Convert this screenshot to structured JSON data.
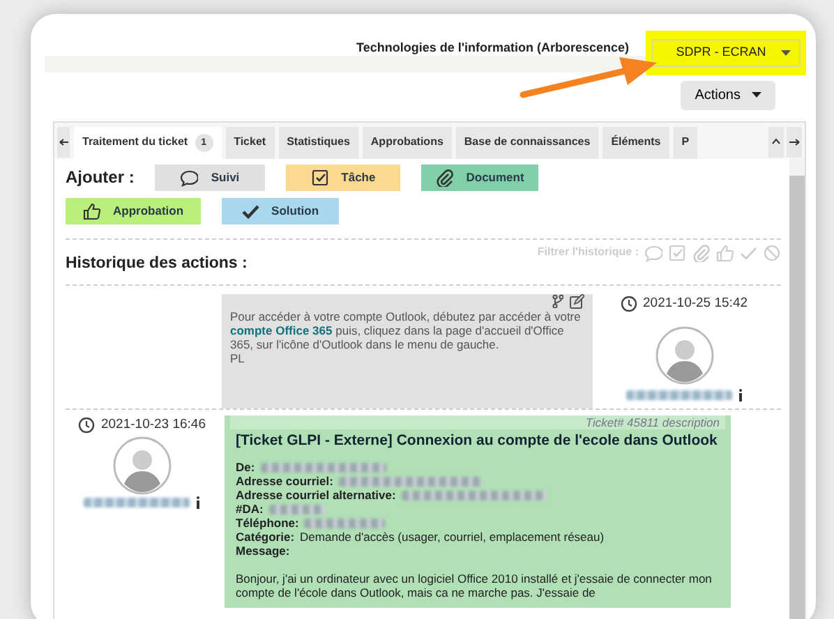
{
  "header": {
    "entity": "Technologies de l'information (Arborescence)",
    "profile": "SDPR - ECRAN",
    "highlighted": true
  },
  "actions_button": "Actions",
  "tabs": [
    {
      "label": "Traitement du ticket",
      "badge": "1",
      "selected": true
    },
    {
      "label": "Ticket",
      "selected": false
    },
    {
      "label": "Statistiques",
      "selected": false
    },
    {
      "label": "Approbations",
      "selected": false
    },
    {
      "label": "Base de connaissances",
      "selected": false
    },
    {
      "label": "Éléments",
      "selected": false
    },
    {
      "label": "P",
      "selected": false
    }
  ],
  "add_label": "Ajouter :",
  "add_buttons": [
    {
      "label": "Suivi",
      "kind": "followup"
    },
    {
      "label": "Tâche",
      "kind": "task"
    },
    {
      "label": "Document",
      "kind": "document"
    },
    {
      "label": "Approbation",
      "kind": "approval"
    },
    {
      "label": "Solution",
      "kind": "solution"
    }
  ],
  "history": {
    "title": "Historique des actions :",
    "filter_label": "Filtrer l'historique :"
  },
  "followup": {
    "date": "2021-10-25 15:42",
    "author_redacted": true,
    "parts": [
      {
        "kind": "text",
        "text": "Pour accéder à votre compte Outlook, débutez par accéder à votre"
      },
      {
        "kind": "link",
        "text": "compte Office 365"
      },
      {
        "kind": "text",
        "text": "puis, cliquez dans la page d'accueil d'Office 365, sur l'icône d'Outlook dans le menu de gauche."
      }
    ],
    "signature": "PL"
  },
  "description": {
    "date": "2021-10-23 16:46",
    "author_redacted": true,
    "ref": "Ticket# 45811 description",
    "subject": "[Ticket GLPI - Externe] Connexion au compte de l'ecole dans Outlook",
    "fields": [
      {
        "label": "De:",
        "redacted": true
      },
      {
        "label": "Adresse courriel:",
        "redacted": true
      },
      {
        "label": "Adresse courriel alternative:",
        "redacted": true
      },
      {
        "label": "#DA:",
        "redacted": true
      },
      {
        "label": "Téléphone:",
        "redacted": true
      },
      {
        "label": "Catégorie:",
        "value": "Demande d'accès (usager, courriel, emplacement réseau)",
        "redacted": false
      },
      {
        "label": "Message:",
        "redacted": false
      }
    ],
    "message": "Bonjour, j'ai un ordinateur avec un logiciel Office 2010 installé et j'essaie de connecter mon compte de l'école dans Outlook, mais ca ne marche pas. J'essaie de"
  }
}
